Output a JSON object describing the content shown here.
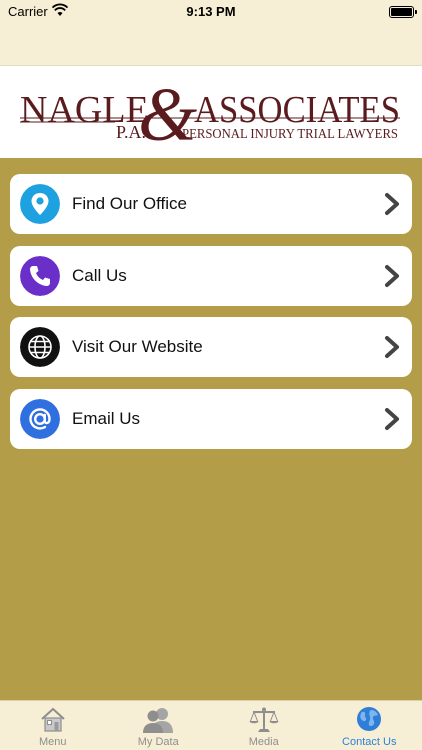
{
  "status_bar": {
    "carrier": "Carrier",
    "time": "9:13 PM"
  },
  "logo": {
    "name_left": "NAGLE",
    "ampersand": "&",
    "name_right": "ASSOCIATES",
    "suffix": "P.A.",
    "tagline": "PERSONAL INJURY TRIAL LAWYERS"
  },
  "menu": [
    {
      "label": "Find Our Office",
      "icon": "location-pin-icon",
      "color": "#1da1e0"
    },
    {
      "label": "Call Us",
      "icon": "phone-icon",
      "color": "#6b2fc9"
    },
    {
      "label": "Visit Our Website",
      "icon": "globe-icon",
      "color": "#111111"
    },
    {
      "label": "Email Us",
      "icon": "at-sign-icon",
      "color": "#2f6fe0"
    }
  ],
  "tabs": [
    {
      "label": "Menu",
      "icon": "house-icon"
    },
    {
      "label": "My Data",
      "icon": "people-icon"
    },
    {
      "label": "Media",
      "icon": "scales-icon"
    },
    {
      "label": "Contact Us",
      "icon": "world-icon",
      "active": true
    }
  ],
  "colors": {
    "background": "#b39d48",
    "bar": "#f7efd5",
    "accent": "#2f7ed8",
    "logo": "#5a1b1e"
  }
}
